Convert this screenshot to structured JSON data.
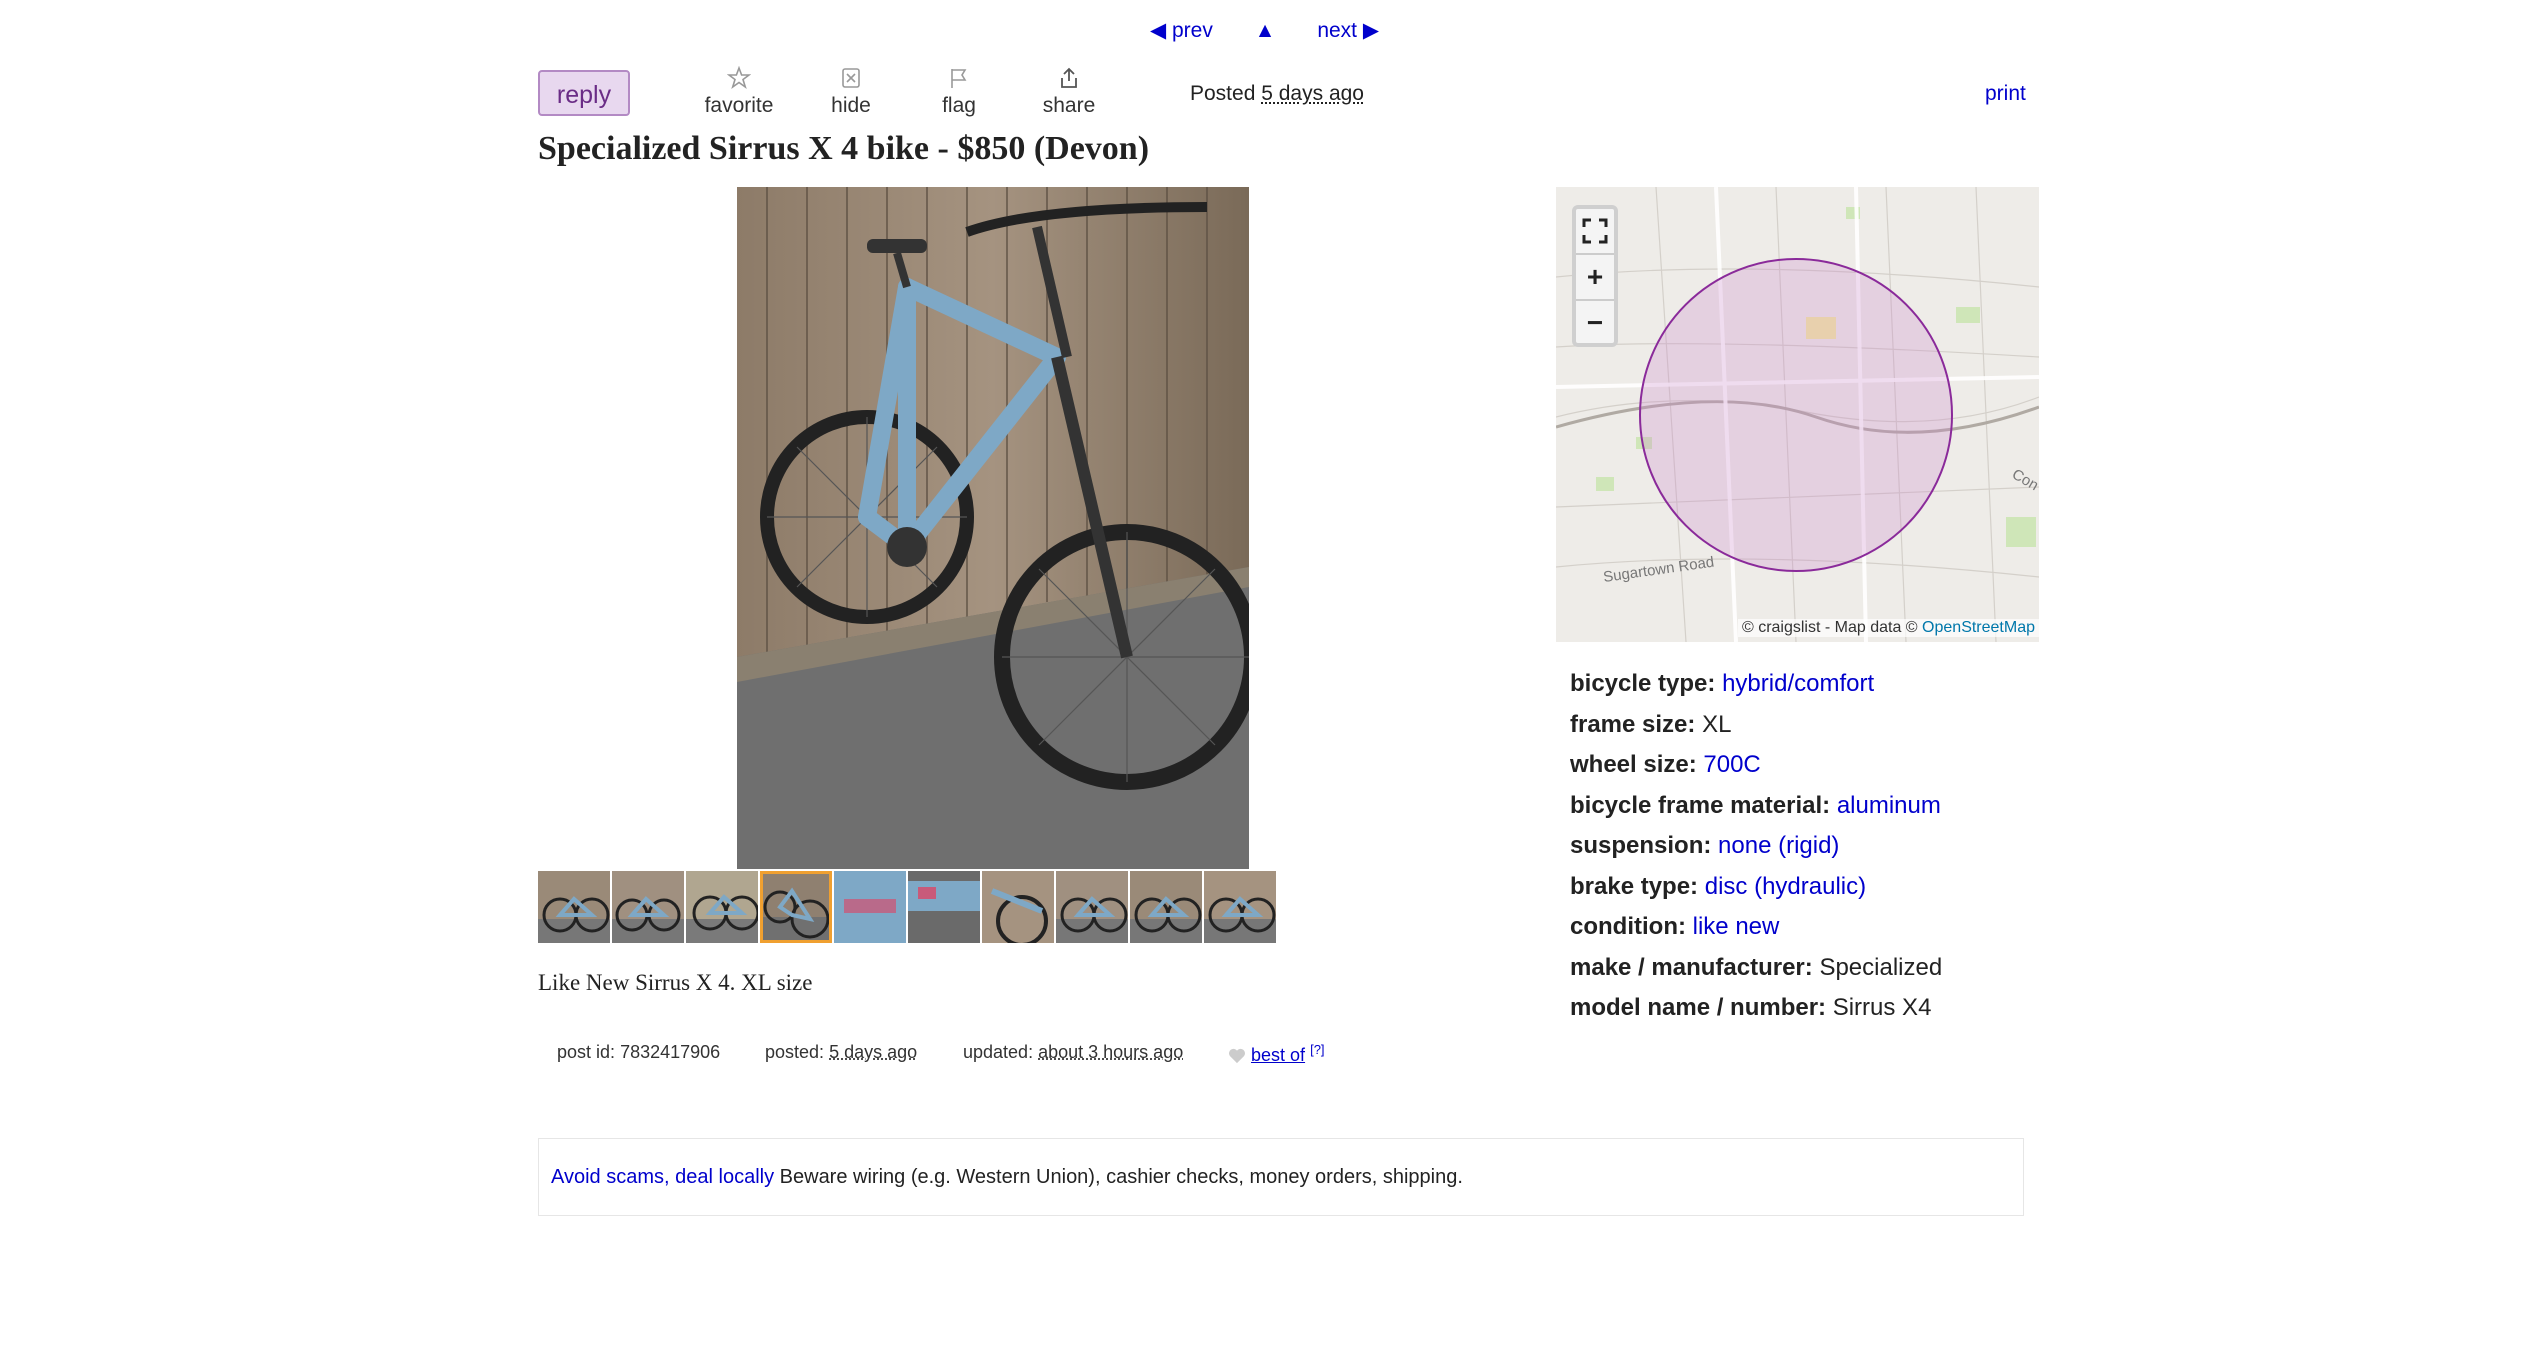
{
  "nav": {
    "prev": "◀ prev",
    "up": "▲",
    "next": "next ▶"
  },
  "actions": {
    "reply": "reply",
    "favorite": "favorite",
    "hide": "hide",
    "flag": "flag",
    "share": "share",
    "posted_label": "Posted",
    "posted_value": "5 days ago",
    "print": "print"
  },
  "title": "Specialized Sirrus X 4 bike - $850 (Devon)",
  "description": "Like New Sirrus X 4. XL size",
  "map": {
    "attribution_prefix": "© craigslist - Map data ©",
    "attribution_link": "OpenStreetMap",
    "road_label_1": "Sugartown Road",
    "road_label_2": "Con",
    "zoom_in": "+",
    "zoom_out": "−"
  },
  "attributes": [
    {
      "label": "bicycle type:",
      "value": "hybrid/comfort",
      "link": true
    },
    {
      "label": "frame size:",
      "value": "XL",
      "link": false
    },
    {
      "label": "wheel size:",
      "value": "700C",
      "link": true
    },
    {
      "label": "bicycle frame material:",
      "value": "aluminum",
      "link": true
    },
    {
      "label": "suspension:",
      "value": "none (rigid)",
      "link": true
    },
    {
      "label": "brake type:",
      "value": "disc (hydraulic)",
      "link": true
    },
    {
      "label": "condition:",
      "value": "like new",
      "link": true
    },
    {
      "label": "make / manufacturer:",
      "value": "Specialized",
      "link": false
    },
    {
      "label": "model name / number:",
      "value": "Sirrus X4",
      "link": false
    }
  ],
  "post_meta": {
    "post_id_label": "post id:",
    "post_id": "7832417906",
    "posted_label": "posted:",
    "posted_value": "5 days ago",
    "updated_label": "updated:",
    "updated_value": "about 3 hours ago",
    "best_of": "best of",
    "best_of_help": "[?]"
  },
  "notice": {
    "link_1": "Avoid scams,",
    "link_2": "deal locally",
    "text": "Beware wiring (e.g. Western Union), cashier checks, money orders, shipping."
  },
  "colors": {
    "accent_link": "#0000cc",
    "reply_bg": "#e8d8ef",
    "map_circle": "#8a2a9a",
    "selected_thumb": "#f0a030"
  },
  "thumbnail_count": 10,
  "selected_thumbnail": 4
}
